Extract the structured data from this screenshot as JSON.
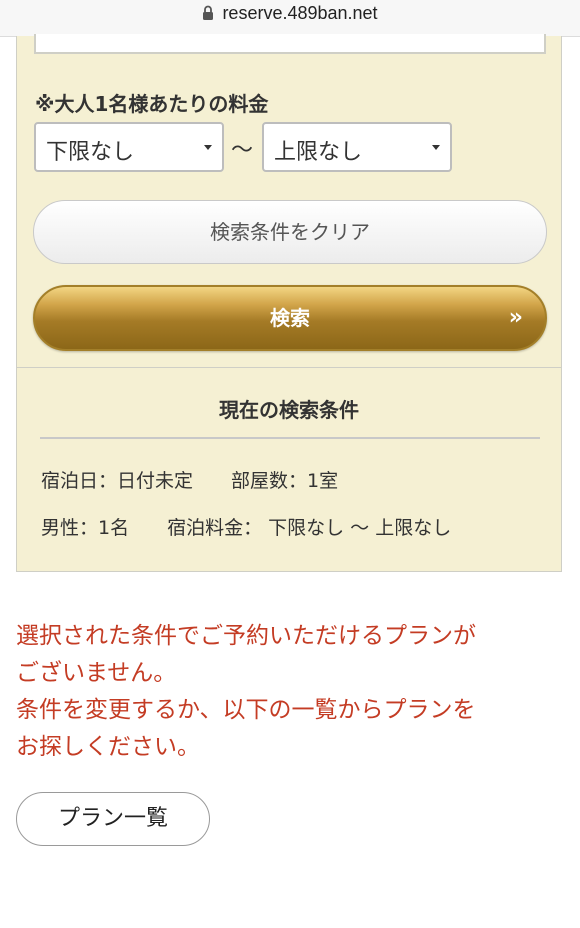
{
  "browser": {
    "url": "reserve.489ban.net",
    "icon": "lock-icon"
  },
  "search_form": {
    "price_label": "※大人1名様あたりの料金",
    "price_min": "下限なし",
    "price_separator": "〜",
    "price_max": "上限なし",
    "clear_button": "検索条件をクリア",
    "search_button": "検索",
    "search_button_icon": "»"
  },
  "current_conditions": {
    "title": "現在の検索条件",
    "stay_date": "宿泊日：日付未定",
    "rooms": "部屋数：1室",
    "male": "男性：1名",
    "price": "宿泊料金： 下限なし 〜 上限なし"
  },
  "notice": {
    "line1": "選択された条件でご予約いただけるプランが",
    "line2": "ございません。",
    "line3": "条件を変更するか、以下の一覧からプランを",
    "line4": "お探しください。"
  },
  "plan_list_button": "プラン一覧",
  "colors": {
    "panel_bg": "#f5f0d3",
    "gold_button": "#a57b26",
    "notice_text": "#c43c24"
  }
}
